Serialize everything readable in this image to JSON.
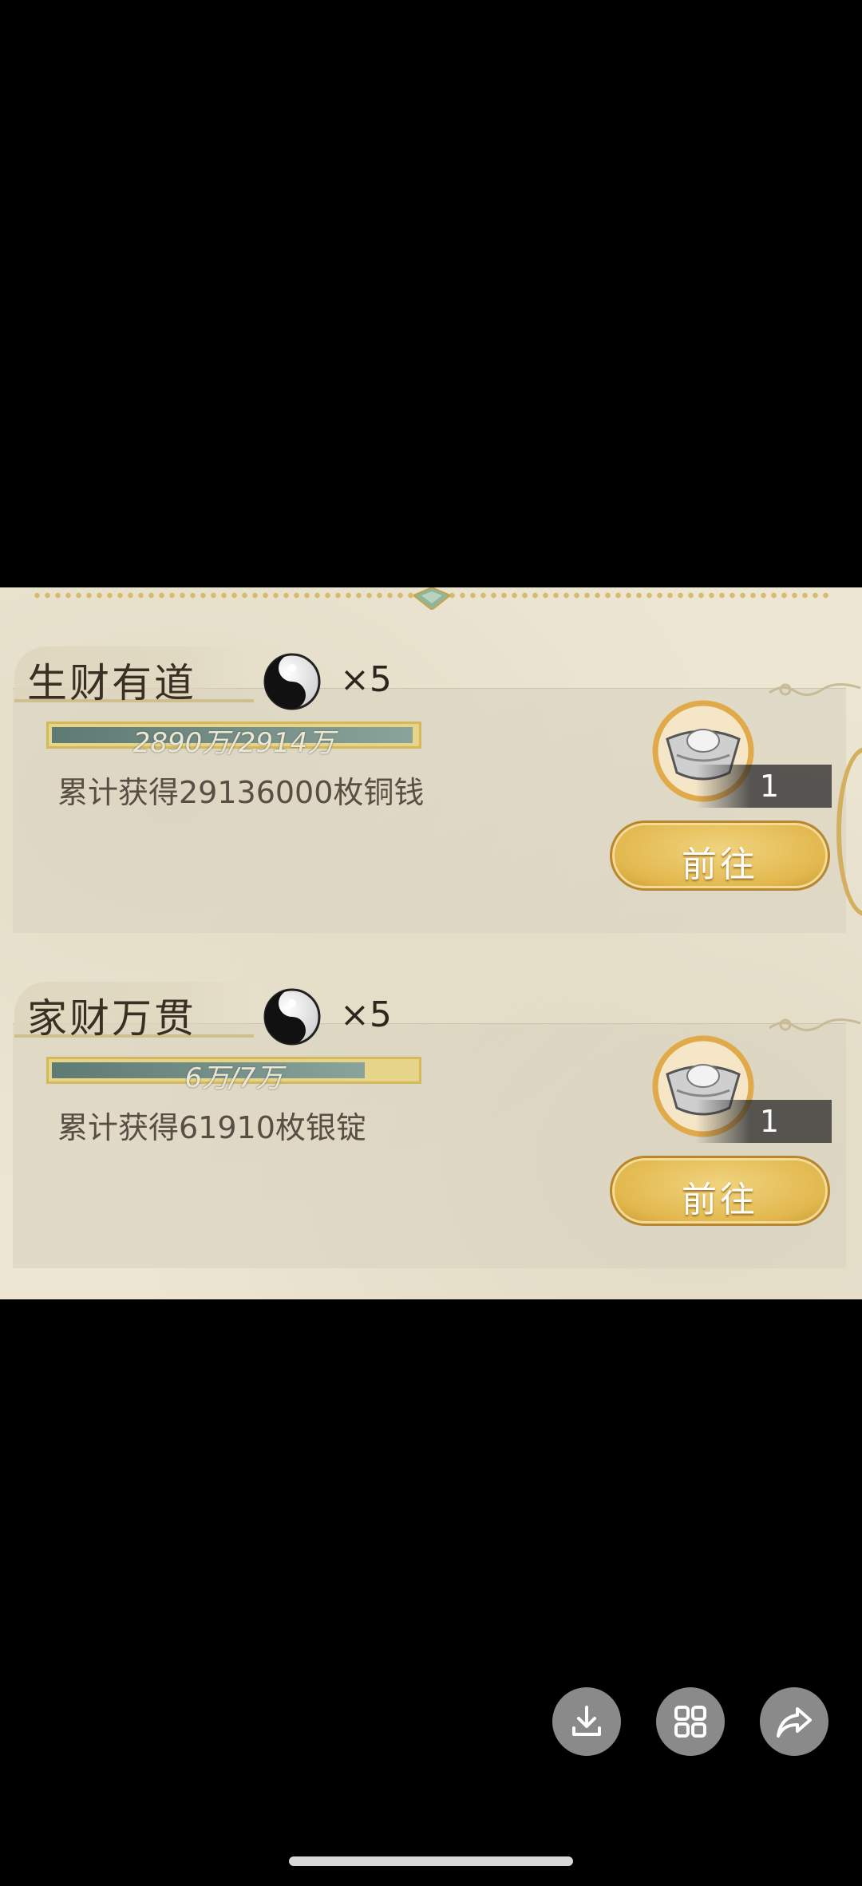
{
  "tasks": [
    {
      "title": "生财有道",
      "multiplier": "×5",
      "progress_text": "2890万/2914万",
      "progress_value": 0.992,
      "description": "累计获得29136000枚铜钱",
      "reward_count": "1",
      "go_label": "前往"
    },
    {
      "title": "家财万贯",
      "multiplier": "×5",
      "progress_text": "6万/7万",
      "progress_value": 0.86,
      "description": "累计获得61910枚银锭",
      "reward_count": "1",
      "go_label": "前往"
    }
  ],
  "icons": {
    "orb": "yin-yang-orb-icon",
    "reward": "silver-ingot-icon",
    "download": "download-icon",
    "grid": "grid-icon",
    "share": "share-icon"
  },
  "colors": {
    "panel_background": "#ece6d3",
    "button_gold": "#e2b84e",
    "progress_fill": "#5d7a73",
    "control_button": "#8a8a8a"
  }
}
